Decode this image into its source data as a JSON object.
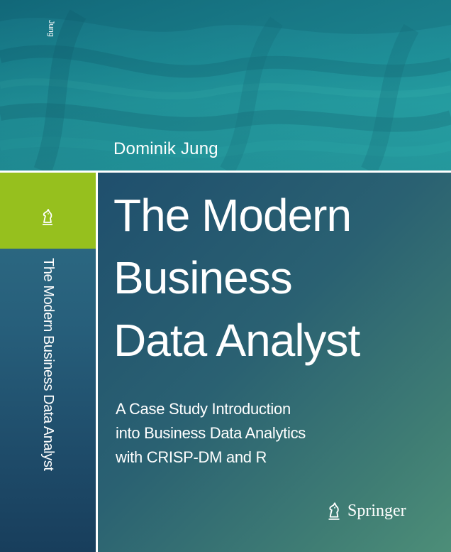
{
  "cover": {
    "spine_author": "Jung",
    "author": "Dominik Jung",
    "title_lines": [
      "The Modern",
      "Business",
      "Data Analyst"
    ],
    "spine_title": "The Modern Business Data Analyst",
    "subtitle_lines": [
      "A Case Study Introduction",
      "into Business Data Analytics",
      "with CRISP-DM and R"
    ],
    "publisher": "Springer",
    "icons": {
      "publisher_logo": "springer-horse-icon",
      "spine_logo": "springer-horse-icon"
    },
    "colors": {
      "accent_green": "#96c01e",
      "banner_teal": "#1b8e99",
      "panel_blue": "#1f4f6d",
      "text": "#ffffff"
    }
  }
}
